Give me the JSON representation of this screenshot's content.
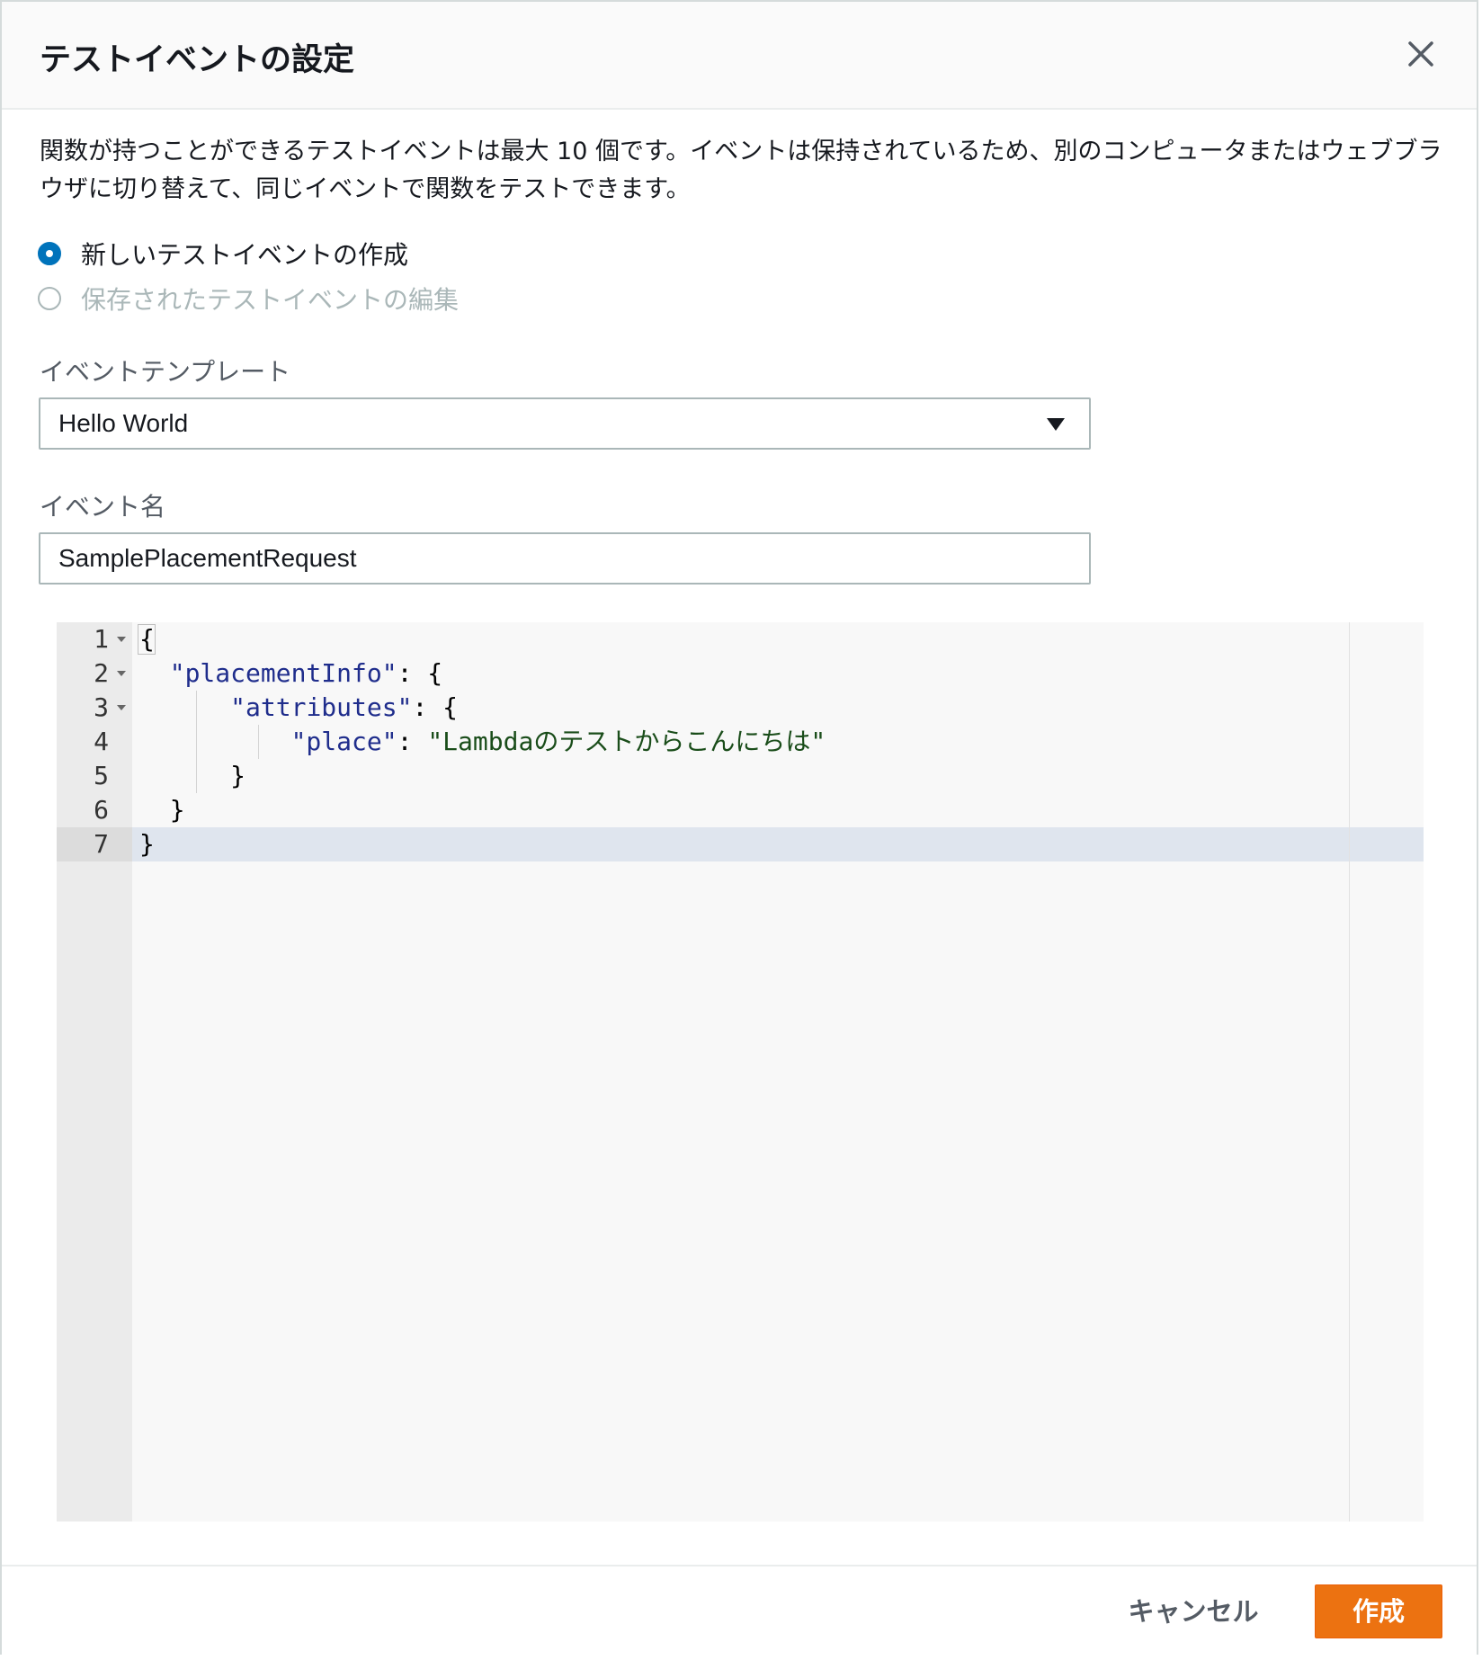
{
  "dialog": {
    "title": "テストイベントの設定",
    "intro": "関数が持つことができるテストイベントは最大 10 個です。イベントは保持されているため、別のコンピュータまたはウェブブラウザに切り替えて、同じイベントで関数をテストできます。"
  },
  "mode": {
    "options": [
      {
        "label": "新しいテストイベントの作成",
        "checked": true,
        "disabled": false
      },
      {
        "label": "保存されたテストイベントの編集",
        "checked": false,
        "disabled": true
      }
    ]
  },
  "template": {
    "label": "イベントテンプレート",
    "value": "Hello World"
  },
  "event_name": {
    "label": "イベント名",
    "value": "SamplePlacementRequest"
  },
  "editor": {
    "line_numbers": [
      "1",
      "2",
      "3",
      "4",
      "5",
      "6",
      "7"
    ],
    "lines": [
      {
        "indent": "",
        "key": "",
        "punct1": "{",
        "value": "",
        "punct2": ""
      },
      {
        "indent": "  ",
        "key": "\"placementInfo\"",
        "punct1": ": {",
        "value": "",
        "punct2": ""
      },
      {
        "indent": "      ",
        "key": "\"attributes\"",
        "punct1": ": {",
        "value": "",
        "punct2": ""
      },
      {
        "indent": "          ",
        "key": "\"place\"",
        "punct1": ": ",
        "value": "\"Lambdaのテストからこんにちは\"",
        "punct2": ""
      },
      {
        "indent": "      ",
        "key": "",
        "punct1": "}",
        "value": "",
        "punct2": ""
      },
      {
        "indent": "  ",
        "key": "",
        "punct1": "}",
        "value": "",
        "punct2": ""
      },
      {
        "indent": "",
        "key": "",
        "punct1": "}",
        "value": "",
        "punct2": ""
      }
    ],
    "active_line": 7
  },
  "footer": {
    "cancel_label": "キャンセル",
    "create_label": "作成"
  },
  "colors": {
    "primary": "#ec7211",
    "radio_selected": "#0073bb"
  }
}
